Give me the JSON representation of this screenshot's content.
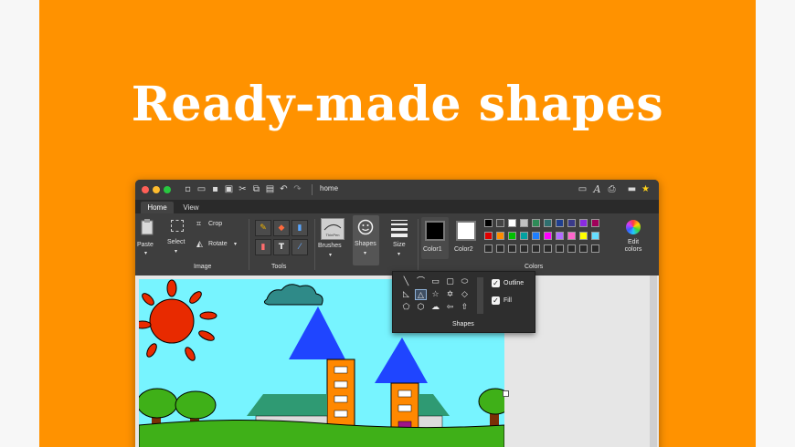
{
  "headline": "Ready-made shapes",
  "window": {
    "title": "home",
    "tabs": [
      "Home",
      "View"
    ],
    "traffic_lights": [
      "#ff5f57",
      "#febc2e",
      "#28c840"
    ]
  },
  "ribbon": {
    "paste_label": "Paste",
    "select_label": "Select",
    "crop_label": "Crop",
    "rotate_label": "Rotate",
    "image_group": "Image",
    "tools_group": "Tools",
    "brushes_label": "Brushes",
    "brush_preview_label": "ThinPen",
    "shapes_label": "Shapes",
    "size_label": "Size",
    "color1_label": "Color1",
    "color2_label": "Color2",
    "colors_group": "Colors",
    "edit_colors_label": "Edit colors",
    "color1": "#000000",
    "color2": "#ffffff"
  },
  "palette": {
    "row1": [
      "#000000",
      "#444444",
      "#ffffff",
      "#c0c0c0",
      "#2e8b57",
      "#2f6f6f",
      "#1f3f8f",
      "#3a3a8a",
      "#8a2be2",
      "#a0005a"
    ],
    "row2": [
      "#e00000",
      "#ff8c00",
      "#00c000",
      "#00a0a0",
      "#1e7fff",
      "#ff00ff",
      "#b06cff",
      "#ff66cc",
      "#ffff00",
      "#66ddff"
    ],
    "row3": [
      "#2a2a2a",
      "#2a2a2a",
      "#2a2a2a",
      "#2a2a2a",
      "#2a2a2a",
      "#2a2a2a",
      "#2a2a2a",
      "#2a2a2a",
      "#2a2a2a",
      "#2a2a2a"
    ]
  },
  "shapes_panel": {
    "title": "Shapes",
    "outline_label": "Outline",
    "fill_label": "Fill",
    "outline_checked": true,
    "fill_checked": true,
    "shapes": [
      "line",
      "curve",
      "rectangle",
      "rounded-rectangle",
      "ellipse",
      "right-triangle",
      "triangle",
      "star-5",
      "star-6",
      "diamond",
      "pentagon",
      "hexagon",
      "cloud",
      "arrow-left",
      "arrow-up"
    ]
  },
  "drawing": {
    "sky_color": "#77f4ff",
    "sun_color": "#e82a00",
    "roof_color": "#1f45ff",
    "tower_color": "#ff8800",
    "house_roof_color": "#2f9a73",
    "door_color": "#a0148a",
    "tree_color": "#3fb018",
    "trunk_color": "#7a2f06"
  }
}
